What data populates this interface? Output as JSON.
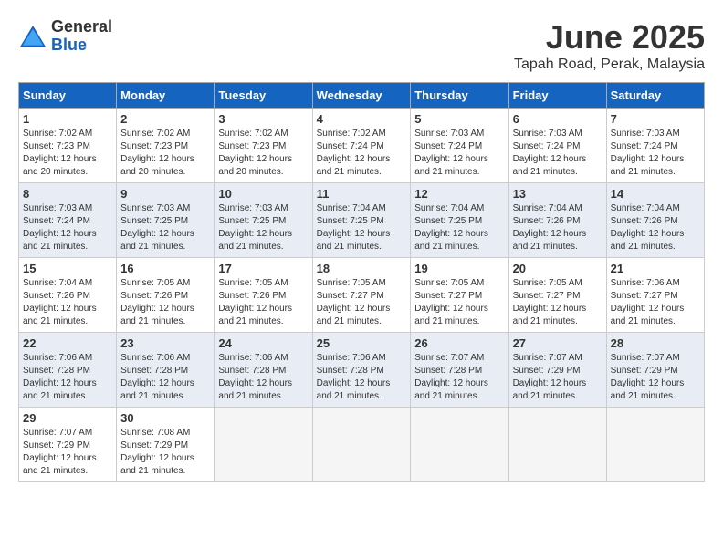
{
  "logo": {
    "general": "General",
    "blue": "Blue"
  },
  "title": {
    "month": "June 2025",
    "location": "Tapah Road, Perak, Malaysia"
  },
  "headers": [
    "Sunday",
    "Monday",
    "Tuesday",
    "Wednesday",
    "Thursday",
    "Friday",
    "Saturday"
  ],
  "weeks": [
    [
      {
        "day": "1",
        "sunrise": "7:02 AM",
        "sunset": "7:23 PM",
        "daylight": "12 hours and 20 minutes."
      },
      {
        "day": "2",
        "sunrise": "7:02 AM",
        "sunset": "7:23 PM",
        "daylight": "12 hours and 20 minutes."
      },
      {
        "day": "3",
        "sunrise": "7:02 AM",
        "sunset": "7:23 PM",
        "daylight": "12 hours and 20 minutes."
      },
      {
        "day": "4",
        "sunrise": "7:02 AM",
        "sunset": "7:24 PM",
        "daylight": "12 hours and 21 minutes."
      },
      {
        "day": "5",
        "sunrise": "7:03 AM",
        "sunset": "7:24 PM",
        "daylight": "12 hours and 21 minutes."
      },
      {
        "day": "6",
        "sunrise": "7:03 AM",
        "sunset": "7:24 PM",
        "daylight": "12 hours and 21 minutes."
      },
      {
        "day": "7",
        "sunrise": "7:03 AM",
        "sunset": "7:24 PM",
        "daylight": "12 hours and 21 minutes."
      }
    ],
    [
      {
        "day": "8",
        "sunrise": "7:03 AM",
        "sunset": "7:24 PM",
        "daylight": "12 hours and 21 minutes."
      },
      {
        "day": "9",
        "sunrise": "7:03 AM",
        "sunset": "7:25 PM",
        "daylight": "12 hours and 21 minutes."
      },
      {
        "day": "10",
        "sunrise": "7:03 AM",
        "sunset": "7:25 PM",
        "daylight": "12 hours and 21 minutes."
      },
      {
        "day": "11",
        "sunrise": "7:04 AM",
        "sunset": "7:25 PM",
        "daylight": "12 hours and 21 minutes."
      },
      {
        "day": "12",
        "sunrise": "7:04 AM",
        "sunset": "7:25 PM",
        "daylight": "12 hours and 21 minutes."
      },
      {
        "day": "13",
        "sunrise": "7:04 AM",
        "sunset": "7:26 PM",
        "daylight": "12 hours and 21 minutes."
      },
      {
        "day": "14",
        "sunrise": "7:04 AM",
        "sunset": "7:26 PM",
        "daylight": "12 hours and 21 minutes."
      }
    ],
    [
      {
        "day": "15",
        "sunrise": "7:04 AM",
        "sunset": "7:26 PM",
        "daylight": "12 hours and 21 minutes."
      },
      {
        "day": "16",
        "sunrise": "7:05 AM",
        "sunset": "7:26 PM",
        "daylight": "12 hours and 21 minutes."
      },
      {
        "day": "17",
        "sunrise": "7:05 AM",
        "sunset": "7:26 PM",
        "daylight": "12 hours and 21 minutes."
      },
      {
        "day": "18",
        "sunrise": "7:05 AM",
        "sunset": "7:27 PM",
        "daylight": "12 hours and 21 minutes."
      },
      {
        "day": "19",
        "sunrise": "7:05 AM",
        "sunset": "7:27 PM",
        "daylight": "12 hours and 21 minutes."
      },
      {
        "day": "20",
        "sunrise": "7:05 AM",
        "sunset": "7:27 PM",
        "daylight": "12 hours and 21 minutes."
      },
      {
        "day": "21",
        "sunrise": "7:06 AM",
        "sunset": "7:27 PM",
        "daylight": "12 hours and 21 minutes."
      }
    ],
    [
      {
        "day": "22",
        "sunrise": "7:06 AM",
        "sunset": "7:28 PM",
        "daylight": "12 hours and 21 minutes."
      },
      {
        "day": "23",
        "sunrise": "7:06 AM",
        "sunset": "7:28 PM",
        "daylight": "12 hours and 21 minutes."
      },
      {
        "day": "24",
        "sunrise": "7:06 AM",
        "sunset": "7:28 PM",
        "daylight": "12 hours and 21 minutes."
      },
      {
        "day": "25",
        "sunrise": "7:06 AM",
        "sunset": "7:28 PM",
        "daylight": "12 hours and 21 minutes."
      },
      {
        "day": "26",
        "sunrise": "7:07 AM",
        "sunset": "7:28 PM",
        "daylight": "12 hours and 21 minutes."
      },
      {
        "day": "27",
        "sunrise": "7:07 AM",
        "sunset": "7:29 PM",
        "daylight": "12 hours and 21 minutes."
      },
      {
        "day": "28",
        "sunrise": "7:07 AM",
        "sunset": "7:29 PM",
        "daylight": "12 hours and 21 minutes."
      }
    ],
    [
      {
        "day": "29",
        "sunrise": "7:07 AM",
        "sunset": "7:29 PM",
        "daylight": "12 hours and 21 minutes."
      },
      {
        "day": "30",
        "sunrise": "7:08 AM",
        "sunset": "7:29 PM",
        "daylight": "12 hours and 21 minutes."
      },
      null,
      null,
      null,
      null,
      null
    ]
  ]
}
